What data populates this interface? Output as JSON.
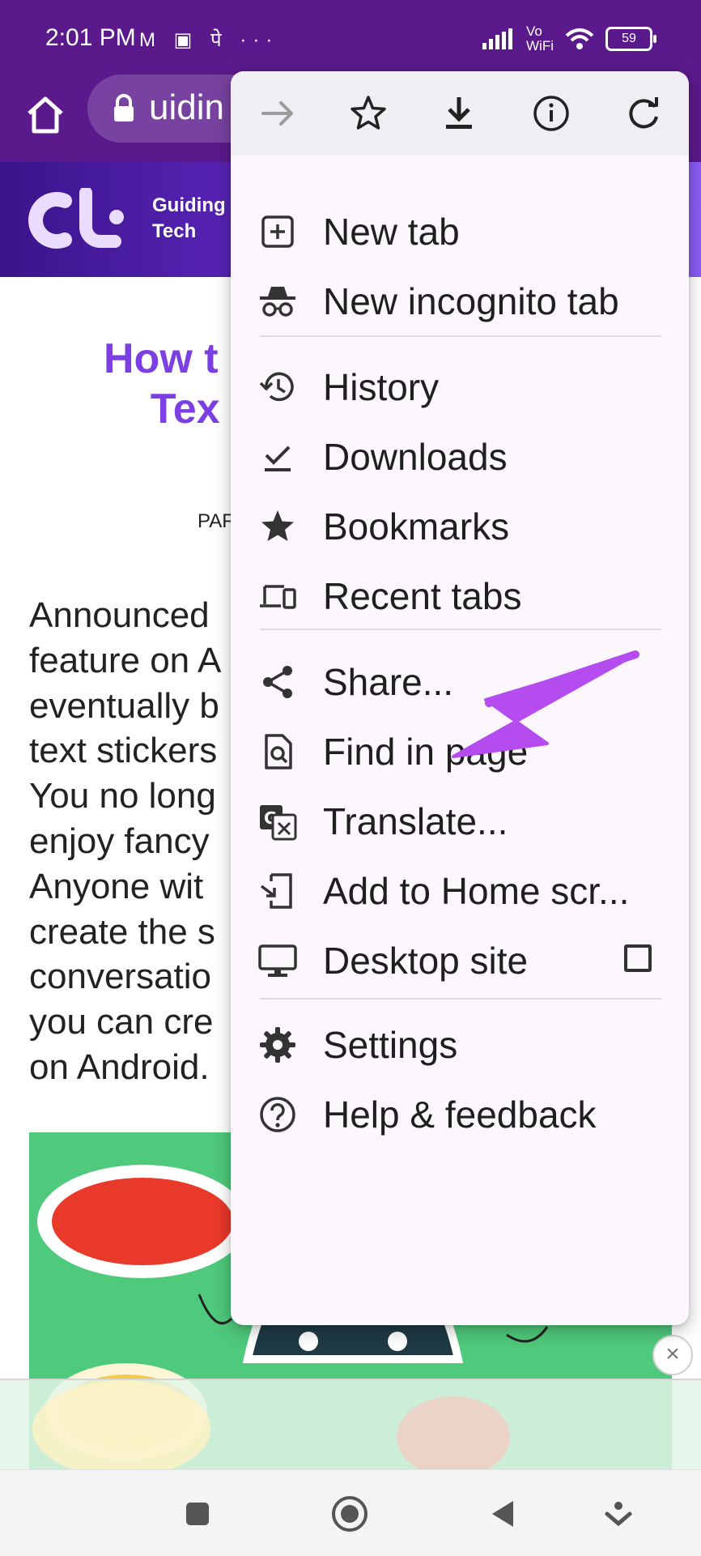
{
  "status_bar": {
    "time": "2:01 PM",
    "notification_icons": [
      "gmail-icon",
      "ola-icon",
      "phonepe-icon",
      "more-dots-icon"
    ],
    "network_label_top": "Vo",
    "network_label_bottom": "WiFi",
    "battery": "59"
  },
  "toolbar": {
    "url": "uidin"
  },
  "site": {
    "name": "Guiding\nTech"
  },
  "article": {
    "title": "How t\n    Tex",
    "byline": "PAF",
    "paragraph": "Announced\nfeature on A\neventually b\ntext stickers\nYou no long\nenjoy fancy\nAnyone wit\ncreate the s\nconversatio\nyou can cre\non Android."
  },
  "menu": {
    "top_icons": [
      "forward-icon",
      "bookmark-star-icon",
      "download-icon",
      "info-icon",
      "refresh-icon"
    ],
    "items": [
      {
        "label": "New tab",
        "icon": "new-tab-icon"
      },
      {
        "label": "New incognito tab",
        "icon": "incognito-icon"
      },
      {
        "label": "History",
        "icon": "history-icon"
      },
      {
        "label": "Downloads",
        "icon": "downloads-icon"
      },
      {
        "label": "Bookmarks",
        "icon": "bookmarks-icon"
      },
      {
        "label": "Recent tabs",
        "icon": "recent-tabs-icon"
      },
      {
        "label": "Share...",
        "icon": "share-icon"
      },
      {
        "label": "Find in page",
        "icon": "find-in-page-icon"
      },
      {
        "label": "Translate...",
        "icon": "translate-icon"
      },
      {
        "label": "Add to Home scr...",
        "icon": "add-to-home-icon"
      },
      {
        "label": "Desktop site",
        "icon": "desktop-icon",
        "checked": false
      },
      {
        "label": "Settings",
        "icon": "settings-icon"
      },
      {
        "label": "Help & feedback",
        "icon": "help-icon"
      }
    ]
  },
  "annotation_color": "#b44cf0",
  "accent_purple": "#5b1a8c"
}
